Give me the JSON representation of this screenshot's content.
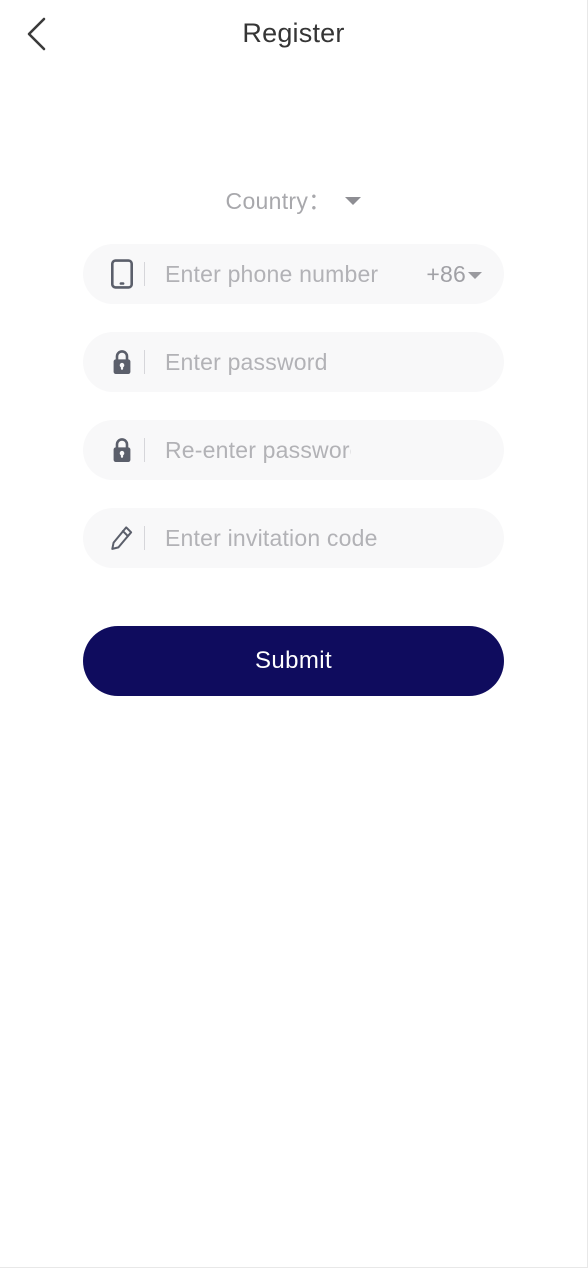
{
  "header": {
    "title": "Register",
    "back_icon": "chevron-left-icon"
  },
  "country_selector": {
    "label": "Country：",
    "caret_icon": "chevron-down-icon",
    "selected": ""
  },
  "form": {
    "fields": [
      {
        "name": "phone",
        "icon": "mobile-phone-icon",
        "placeholder": "Enter phone number",
        "value": "",
        "country_code": "+86",
        "country_code_caret_icon": "chevron-down-icon"
      },
      {
        "name": "password",
        "icon": "lock-icon",
        "placeholder": "Enter password",
        "value": ""
      },
      {
        "name": "confirm-password",
        "icon": "lock-icon",
        "placeholder": "Re-enter password",
        "value": ""
      },
      {
        "name": "invitation-code",
        "icon": "pencil-icon",
        "placeholder": "Enter invitation code",
        "value": ""
      }
    ]
  },
  "submit": {
    "label": "Submit"
  },
  "colors": {
    "accent": "#0f0c5e",
    "field_background": "#f8f8f9",
    "placeholder": "#b2b2b6",
    "title": "#353535",
    "icon": "#5b5f6b"
  }
}
